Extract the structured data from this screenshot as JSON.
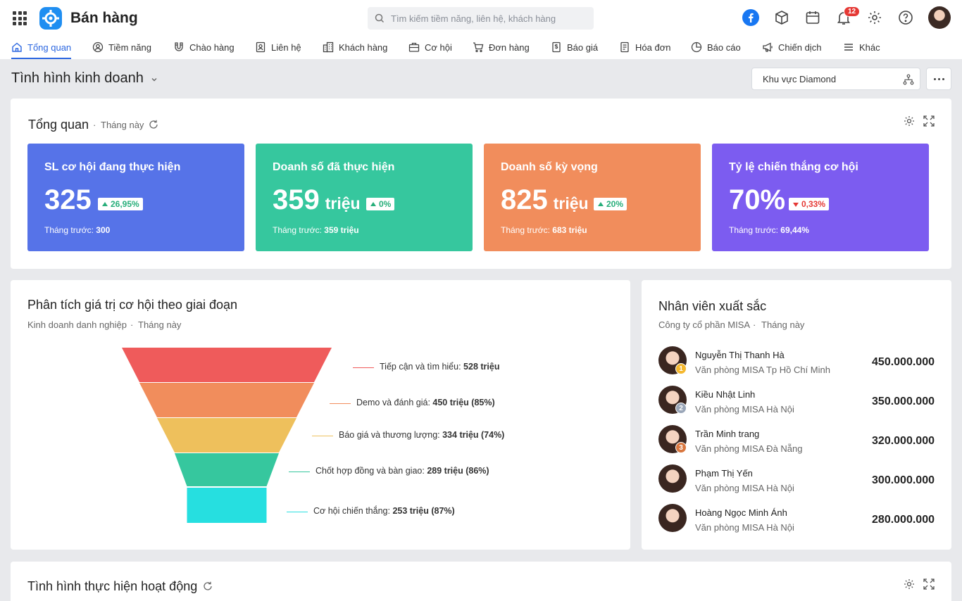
{
  "app": {
    "title": "Bán hàng"
  },
  "search": {
    "placeholder": "Tìm kiếm tiềm năng, liên hệ, khách hàng"
  },
  "header": {
    "notification_count": "12"
  },
  "nav": {
    "items": [
      {
        "label": "Tổng quan",
        "icon": "home-icon",
        "active": true
      },
      {
        "label": "Tiềm năng",
        "icon": "person-circle-icon"
      },
      {
        "label": "Chào hàng",
        "icon": "magnet-icon"
      },
      {
        "label": "Liên hệ",
        "icon": "contact-card-icon"
      },
      {
        "label": "Khách hàng",
        "icon": "building-icon"
      },
      {
        "label": "Cơ hội",
        "icon": "briefcase-icon"
      },
      {
        "label": "Đơn hàng",
        "icon": "cart-icon"
      },
      {
        "label": "Báo giá",
        "icon": "dollar-doc-icon"
      },
      {
        "label": "Hóa đơn",
        "icon": "invoice-icon"
      },
      {
        "label": "Báo cáo",
        "icon": "pie-chart-icon"
      },
      {
        "label": "Chiến dịch",
        "icon": "megaphone-icon"
      },
      {
        "label": "Khác",
        "icon": "menu-icon"
      }
    ]
  },
  "page": {
    "title": "Tình hình kinh doanh",
    "region": "Khu vực Diamond"
  },
  "overview": {
    "title": "Tổng quan",
    "period": "Tháng này",
    "kpis": [
      {
        "title": "SL cơ hội đang thực hiện",
        "value": "325",
        "unit": "",
        "change": "26,95%",
        "direction": "up",
        "prev_label": "Tháng trước:",
        "prev_value": "300",
        "color": "#5673e8"
      },
      {
        "title": "Doanh số đã thực hiện",
        "value": "359",
        "unit": "triệu",
        "change": "0%",
        "direction": "up",
        "prev_label": "Tháng trước:",
        "prev_value": "359 triệu",
        "color": "#36c79e"
      },
      {
        "title": "Doanh số kỳ vọng",
        "value": "825",
        "unit": "triệu",
        "change": "20%",
        "direction": "up",
        "prev_label": "Tháng trước:",
        "prev_value": "683 triệu",
        "color": "#f18d5c"
      },
      {
        "title": "Tỷ lệ chiến thắng cơ hội",
        "value": "70%",
        "unit": "",
        "change": "0,33%",
        "direction": "down",
        "prev_label": "Tháng trước:",
        "prev_value": "69,44%",
        "color": "#7c5cf0"
      }
    ]
  },
  "funnel": {
    "title": "Phân tích giá trị cơ hội theo giai đoạn",
    "subtitle": "Kinh doanh danh nghiệp",
    "period": "Tháng này"
  },
  "chart_data": {
    "type": "funnel",
    "stages": [
      {
        "name": "Tiếp cận và tìm hiểu:",
        "value_label": "528 triệu",
        "value": 528,
        "color": "#ef5b5b"
      },
      {
        "name": "Demo và đánh giá:",
        "value_label": "450 triệu (85%)",
        "value": 450,
        "color": "#f18d5c"
      },
      {
        "name": "Báo giá và thương lượng:",
        "value_label": "334 triệu (74%)",
        "value": 334,
        "color": "#eec05c"
      },
      {
        "name": "Chốt hợp đồng và bàn giao:",
        "value_label": "289 triệu (86%)",
        "value": 289,
        "color": "#36c79e"
      },
      {
        "name": "Cơ hội chiến thắng:",
        "value_label": "253 triệu (87%)",
        "value": 253,
        "color": "#26dfe0"
      }
    ]
  },
  "top_employees": {
    "title": "Nhân viên xuất sắc",
    "subtitle": "Công ty cổ phần MISA",
    "period": "Tháng này",
    "items": [
      {
        "rank": "1",
        "name": "Nguyễn Thị Thanh Hà",
        "office": "Văn phòng MISA Tp Hồ Chí Minh",
        "value": "450.000.000",
        "rank_color": "#f5b82e"
      },
      {
        "rank": "2",
        "name": "Kiều Nhật Linh",
        "office": "Văn phòng MISA Hà Nội",
        "value": "350.000.000",
        "rank_color": "#9aa6b8"
      },
      {
        "rank": "3",
        "name": "Trần Minh trang",
        "office": "Văn phòng MISA Đà Nẵng",
        "value": "320.000.000",
        "rank_color": "#d9773f"
      },
      {
        "rank": "",
        "name": "Phạm Thị Yến",
        "office": "Văn phòng MISA Hà Nội",
        "value": "300.000.000"
      },
      {
        "rank": "",
        "name": "Hoàng Ngọc Minh Ánh",
        "office": "Văn phòng MISA Hà Nội",
        "value": "280.000.000"
      }
    ]
  },
  "activity": {
    "title": "Tình hình thực hiện hoạt động"
  }
}
